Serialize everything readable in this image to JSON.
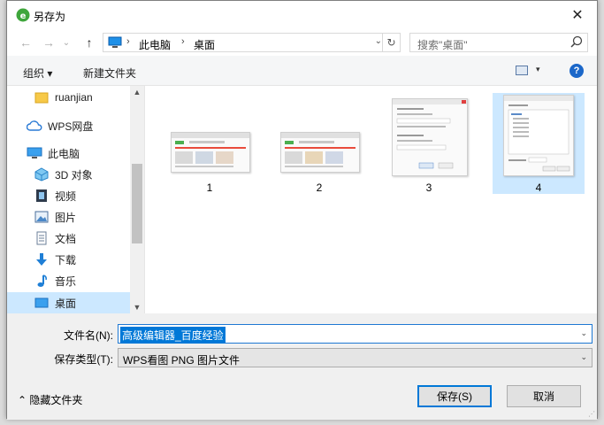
{
  "window": {
    "title": "另存为",
    "close_glyph": "✕"
  },
  "nav": {
    "back_glyph": "←",
    "forward_glyph": "→",
    "recent_glyph": "⌄",
    "up_glyph": "↑",
    "breadcrumb": [
      "此电脑",
      "桌面"
    ],
    "separator_glyph": "›",
    "dropdown_glyph": "⌄",
    "refresh_glyph": "↻",
    "search_placeholder": "搜索\"桌面\""
  },
  "toolbar": {
    "organize_label": "组织 ▾",
    "new_folder_label": "新建文件夹",
    "view_dropdown_glyph": "▾",
    "help_glyph": "?"
  },
  "sidebar": {
    "items": [
      {
        "label": "ruanjian",
        "icon": "folder-icon"
      },
      {
        "label": "WPS网盘",
        "icon": "cloud-icon"
      },
      {
        "label": "此电脑",
        "icon": "computer-icon"
      },
      {
        "label": "3D 对象",
        "icon": "cube-icon"
      },
      {
        "label": "视频",
        "icon": "video-icon"
      },
      {
        "label": "图片",
        "icon": "picture-icon"
      },
      {
        "label": "文档",
        "icon": "document-icon"
      },
      {
        "label": "下载",
        "icon": "download-icon"
      },
      {
        "label": "音乐",
        "icon": "music-icon"
      },
      {
        "label": "桌面",
        "icon": "desktop-icon",
        "selected": true
      }
    ],
    "scroll_up_glyph": "▲",
    "scroll_down_glyph": "▼"
  },
  "files": [
    {
      "name": "1"
    },
    {
      "name": "2"
    },
    {
      "name": "3"
    },
    {
      "name": "4",
      "selected": true
    }
  ],
  "form": {
    "filename_label": "文件名(N):",
    "filename_value": "高级编辑器_百度经验",
    "filetype_label": "保存类型(T):",
    "filetype_value": "WPS看图 PNG 图片文件",
    "dropdown_glyph": "⌄",
    "hide_folders_label": "⌃ 隐藏文件夹",
    "save_label": "保存(S)",
    "cancel_label": "取消"
  },
  "colors": {
    "accent": "#0078d7",
    "selection": "#cce8ff"
  }
}
